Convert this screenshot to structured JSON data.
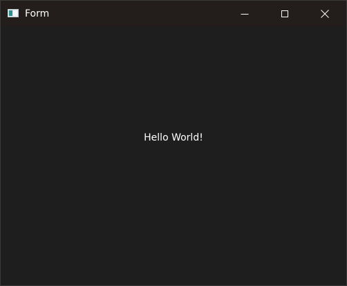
{
  "window": {
    "title": "Form",
    "icon": "form-icon"
  },
  "caption_buttons": {
    "minimize_icon": "minimize-icon",
    "maximize_icon": "maximize-icon",
    "close_icon": "close-icon"
  },
  "content": {
    "label": "Hello World!"
  }
}
